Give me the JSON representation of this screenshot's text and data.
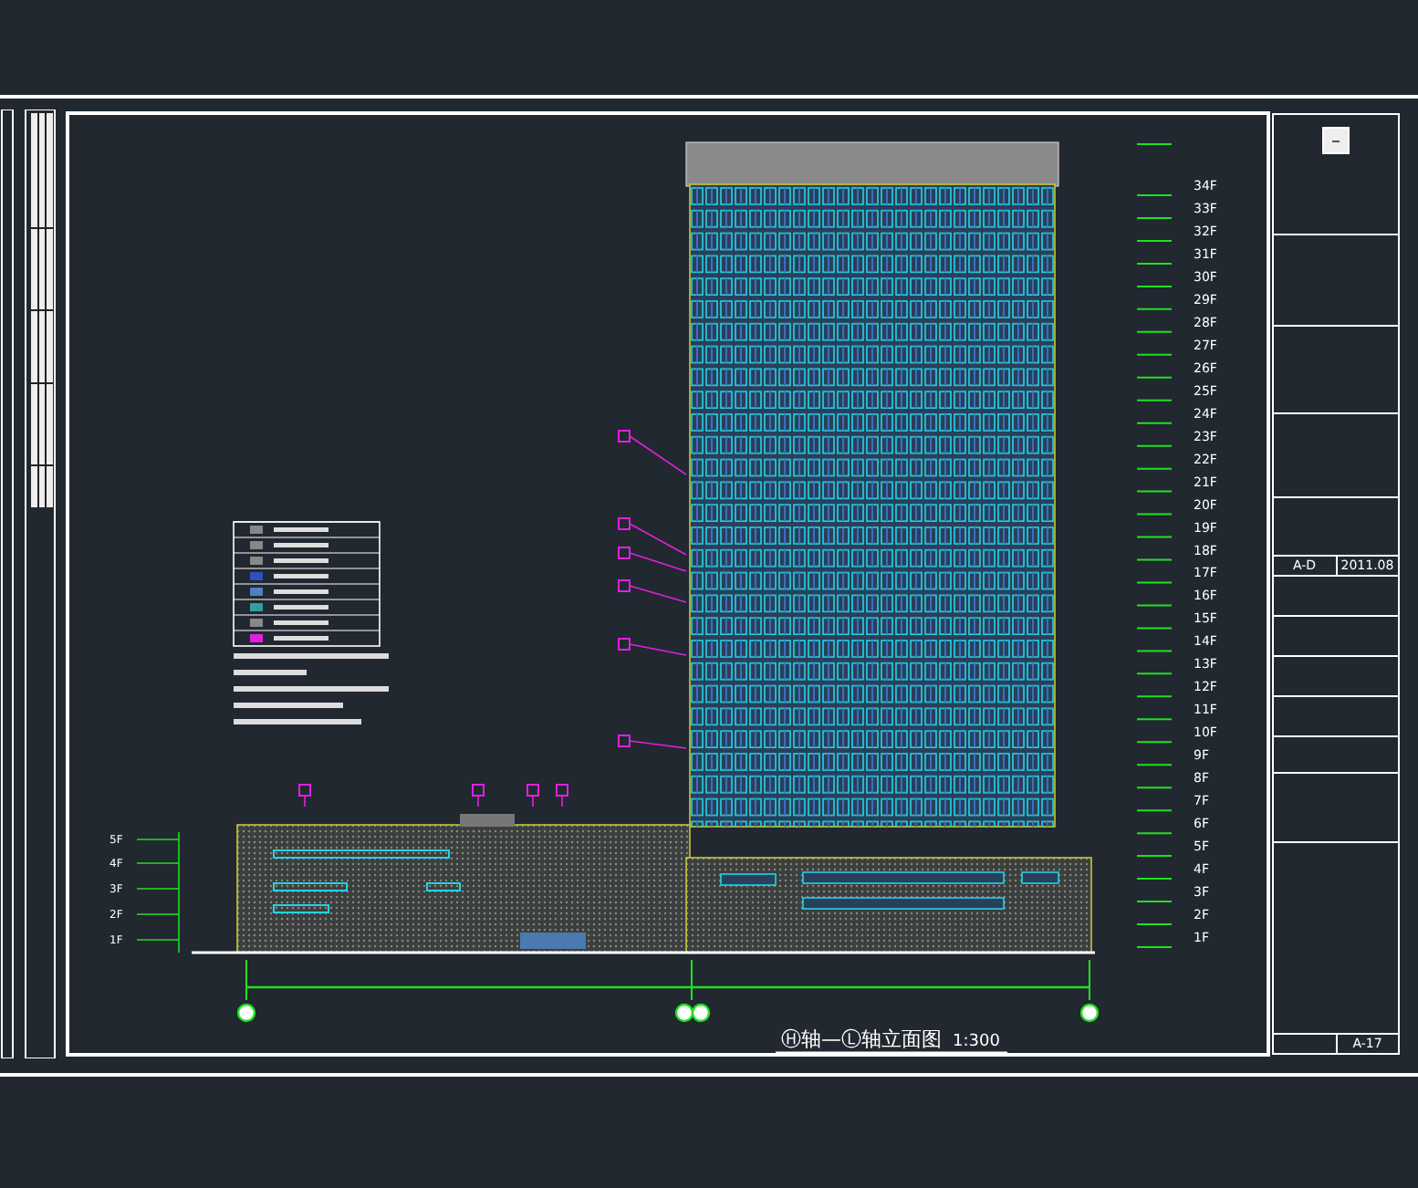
{
  "drawing": {
    "title": "Ⓗ轴—Ⓛ轴立面图",
    "scale": "1:300",
    "tower_floor_labels": [
      "34F",
      "33F",
      "32F",
      "31F",
      "30F",
      "29F",
      "28F",
      "27F",
      "26F",
      "25F",
      "24F",
      "23F",
      "22F",
      "21F",
      "20F",
      "19F",
      "18F",
      "17F",
      "16F",
      "15F",
      "14F",
      "13F",
      "12F",
      "11F",
      "10F",
      "9F",
      "8F",
      "7F",
      "6F",
      "5F",
      "4F",
      "3F",
      "2F",
      "1F"
    ],
    "podium_floor_labels": [
      "5F",
      "4F",
      "3F",
      "2F",
      "1F"
    ]
  },
  "title_block": {
    "revision": "A-D",
    "date": "2011.08",
    "sheet_number": "A-17"
  }
}
